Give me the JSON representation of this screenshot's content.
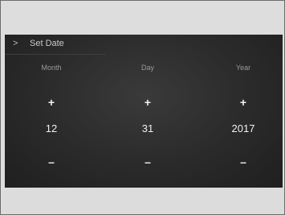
{
  "header": {
    "title": "Set Date",
    "back_icon": "chevron-right-icon"
  },
  "columns": [
    {
      "key": "month",
      "label": "Month",
      "value": "12",
      "plus": "+",
      "minus": "–"
    },
    {
      "key": "day",
      "label": "Day",
      "value": "31",
      "plus": "+",
      "minus": "–"
    },
    {
      "key": "year",
      "label": "Year",
      "value": "2017",
      "plus": "+",
      "minus": "–"
    }
  ]
}
